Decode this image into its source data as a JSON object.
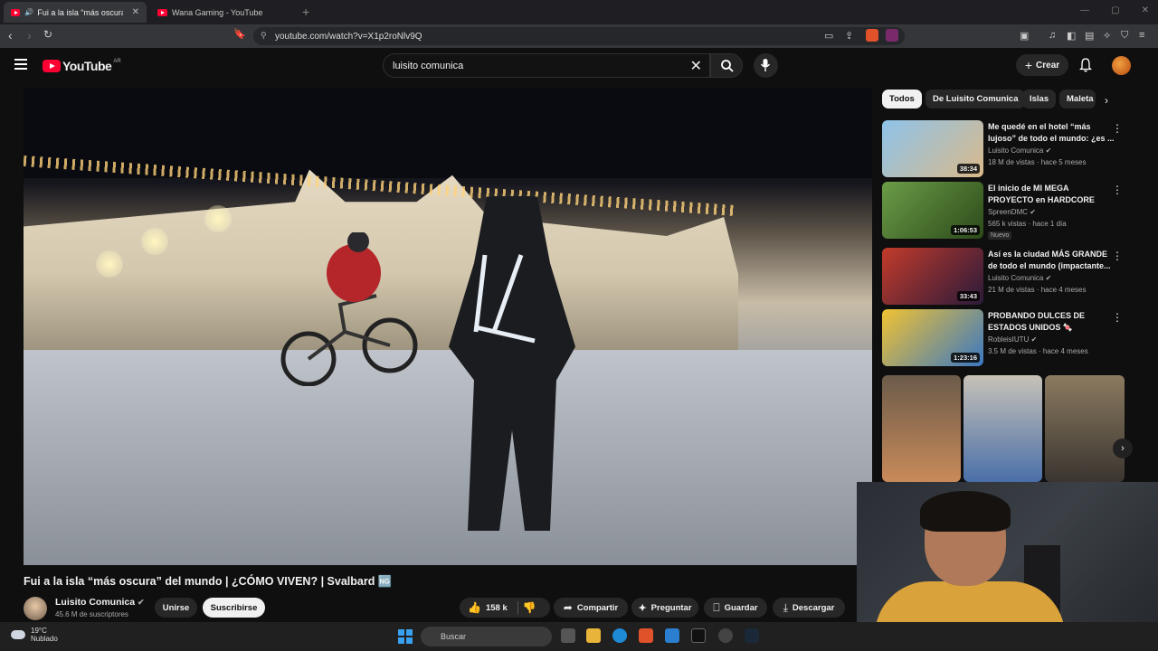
{
  "browser": {
    "tabs": [
      {
        "label": "Fui a la isla “más oscura” del",
        "active": true
      },
      {
        "label": "Wana Gaming - YouTube",
        "active": false
      }
    ],
    "new_tab": "+",
    "url": "youtube.com/watch?v=X1p2roNlv9Q"
  },
  "youtube": {
    "logo_text": "YouTube",
    "country_code": "AR",
    "search_value": "luisito comunica",
    "create_label": "Crear"
  },
  "video": {
    "title": "Fui a la isla “más oscura” del mundo | ¿CÓMO VIVEN? | Svalbard 🆖",
    "channel_name": "Luisito Comunica",
    "subscribers": "45.6 M de suscriptores",
    "join_label": "Unirse",
    "subscribe_label": "Suscribirse",
    "likes": "158 k",
    "share_label": "Compartir",
    "ask_label": "Preguntar",
    "save_label": "Guardar",
    "download_label": "Descargar"
  },
  "chips": [
    "Todos",
    "De Luisito Comunica",
    "Islas",
    "Maleta"
  ],
  "recommendations": [
    {
      "title": "Me quedé en el hotel “más lujoso” de todo el mundo: ¿es ...",
      "channel": "Luisito Comunica",
      "meta": "18 M de vistas · hace 5 meses",
      "duration": "38:34",
      "badge": "",
      "thumb_color": "#7fb0d8"
    },
    {
      "title": "El inicio de MI MEGA PROYECTO en HARDCORE",
      "channel": "SpreenDMC",
      "meta": "565 k vistas · hace 1 día",
      "duration": "1:06:53",
      "badge": "Nuevo",
      "thumb_color": "#5a8a3c"
    },
    {
      "title": "Así es la ciudad MÁS GRANDE de todo el mundo (impactante...",
      "channel": "Luisito Comunica",
      "meta": "21 M de vistas · hace 4 meses",
      "duration": "33:43",
      "badge": "",
      "thumb_color": "#7a2a1e"
    },
    {
      "title": "PROBANDO DULCES DE ESTADOS UNIDOS 🍬",
      "channel": "RobleisIUTU",
      "meta": "3.5 M de vistas · hace 4 meses",
      "duration": "1:23:16",
      "badge": "",
      "thumb_color": "#3a78c2"
    }
  ],
  "taskbar": {
    "temperature": "19°C",
    "condition": "Nublado",
    "search_label": "Buscar"
  },
  "colors": {
    "youtube_red": "#ff0033",
    "bg": "#0f0f0f"
  }
}
